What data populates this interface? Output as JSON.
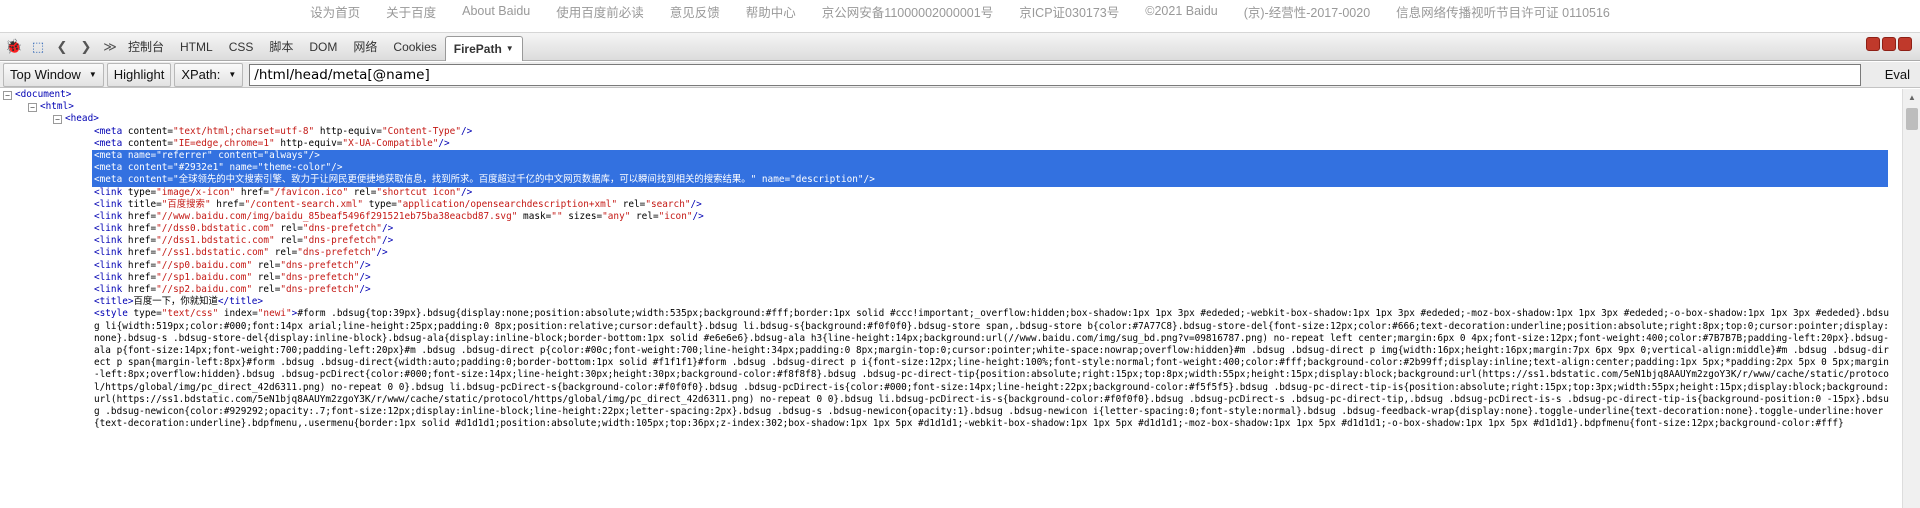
{
  "footer_links": [
    "设为首页",
    "关于百度",
    "About Baidu",
    "使用百度前必读",
    "意见反馈",
    "帮助中心",
    "京公网安备11000002000001号",
    "京ICP证030173号",
    "©2021 Baidu",
    "(京)-经营性-2017-0020",
    "信息网络传播视听节目许可证 0110516"
  ],
  "toolbar": {
    "tabs": [
      "控制台",
      "HTML",
      "CSS",
      "脚本",
      "DOM",
      "网络",
      "Cookies"
    ],
    "active_tab": "FirePath"
  },
  "xpath_bar": {
    "scope": "Top Window",
    "highlight": "Highlight",
    "xpath_label": "XPath:",
    "xpath_value": "/html/head/meta[@name]",
    "eval": "Eval"
  },
  "tree": {
    "document": "<document>",
    "html": "<html>",
    "head": "<head>",
    "meta1": {
      "content": "text/html;charset=utf-8",
      "http_equiv": "Content-Type"
    },
    "meta2": {
      "content": "IE=edge,chrome=1",
      "http_equiv": "X-UA-Compatible"
    },
    "meta3": {
      "name": "referrer",
      "content": "always"
    },
    "meta4": {
      "content": "#2932e1",
      "name": "theme-color"
    },
    "meta5": {
      "content": "全球领先的中文搜索引擎、致力于让网民更便捷地获取信息，找到所求。百度超过千亿的中文网页数据库，可以瞬间找到相关的搜索结果。",
      "name": "description"
    },
    "link1": {
      "type": "image/x-icon",
      "href": "/favicon.ico",
      "rel": "shortcut icon"
    },
    "link2": {
      "title": "百度搜索",
      "href": "/content-search.xml",
      "type": "application/opensearchdescription+xml",
      "rel": "search"
    },
    "link3": {
      "href": "//www.baidu.com/img/baidu_85beaf5496f291521eb75ba38eacbd87.svg",
      "mask": "",
      "sizes": "any",
      "rel": "icon"
    },
    "prefetch": [
      "//dss0.bdstatic.com",
      "//dss1.bdstatic.com",
      "//ss1.bdstatic.com",
      "//sp0.baidu.com",
      "//sp1.baidu.com",
      "//sp2.baidu.com"
    ],
    "title_text": "百度一下，你就知道",
    "style_type": "text/css",
    "style_index": "newi",
    "style_body": "#form .bdsug{top:39px}.bdsug{display:none;position:absolute;width:535px;background:#fff;border:1px solid #ccc!important;_overflow:hidden;box-shadow:1px 1px 3px #ededed;-webkit-box-shadow:1px 1px 3px #ededed;-moz-box-shadow:1px 1px 3px #ededed;-o-box-shadow:1px 1px 3px #ededed}.bdsug li{width:519px;color:#000;font:14px arial;line-height:25px;padding:0 8px;position:relative;cursor:default}.bdsug li.bdsug-s{background:#f0f0f0}.bdsug-store span,.bdsug-store b{color:#7A77C8}.bdsug-store-del{font-size:12px;color:#666;text-decoration:underline;position:absolute;right:8px;top:0;cursor:pointer;display:none}.bdsug-s .bdsug-store-del{display:inline-block}.bdsug-ala{display:inline-block;border-bottom:1px solid #e6e6e6}.bdsug-ala h3{line-height:14px;background:url(//www.baidu.com/img/sug_bd.png?v=09816787.png) no-repeat left center;margin:6px 0 4px;font-size:12px;font-weight:400;color:#7B7B7B;padding-left:20px}.bdsug-ala p{font-size:14px;font-weight:700;padding-left:20px}#m .bdsug .bdsug-direct p{color:#00c;font-weight:700;line-height:34px;padding:0 8px;margin-top:0;cursor:pointer;white-space:nowrap;overflow:hidden}#m .bdsug .bdsug-direct p img{width:16px;height:16px;margin:7px 6px 9px 0;vertical-align:middle}#m .bdsug .bdsug-direct p span{margin-left:8px}#form .bdsug .bdsug-direct{width:auto;padding:0;border-bottom:1px solid #f1f1f1}#form .bdsug .bdsug-direct p i{font-size:12px;line-height:100%;font-style:normal;font-weight:400;color:#fff;background-color:#2b99ff;display:inline;text-align:center;padding:1px 5px;*padding:2px 5px 0 5px;margin-left:8px;overflow:hidden}.bdsug .bdsug-pcDirect{color:#000;font-size:14px;line-height:30px;height:30px;background-color:#f8f8f8}.bdsug .bdsug-pc-direct-tip{position:absolute;right:15px;top:8px;width:55px;height:15px;display:block;background:url(https://ss1.bdstatic.com/5eN1bjq8AAUYm2zgoY3K/r/www/cache/static/protocol/https/global/img/pc_direct_42d6311.png) no-repeat 0 0}.bdsug li.bdsug-pcDirect-s{background-color:#f0f0f0}.bdsug .bdsug-pcDirect-is{color:#000;font-size:14px;line-height:22px;background-color:#f5f5f5}.bdsug .bdsug-pc-direct-tip-is{position:absolute;right:15px;top:3px;width:55px;height:15px;display:block;background:url(https://ss1.bdstatic.com/5eN1bjq8AAUYm2zgoY3K/r/www/cache/static/protocol/https/global/img/pc_direct_42d6311.png) no-repeat 0 0}.bdsug li.bdsug-pcDirect-is-s{background-color:#f0f0f0}.bdsug .bdsug-pcDirect-s .bdsug-pc-direct-tip,.bdsug .bdsug-pcDirect-is-s .bdsug-pc-direct-tip-is{background-position:0 -15px}.bdsug .bdsug-newicon{color:#929292;opacity:.7;font-size:12px;display:inline-block;line-height:22px;letter-spacing:2px}.bdsug .bdsug-s .bdsug-newicon{opacity:1}.bdsug .bdsug-newicon i{letter-spacing:0;font-style:normal}.bdsug .bdsug-feedback-wrap{display:none}.toggle-underline{text-decoration:none}.toggle-underline:hover{text-decoration:underline}.bdpfmenu,.usermenu{border:1px solid #d1d1d1;position:absolute;width:105px;top:36px;z-index:302;box-shadow:1px 1px 5px #d1d1d1;-webkit-box-shadow:1px 1px 5px #d1d1d1;-moz-box-shadow:1px 1px 5px #d1d1d1;-o-box-shadow:1px 1px 5px #d1d1d1}.bdpfmenu{font-size:12px;background-color:#fff}"
  }
}
